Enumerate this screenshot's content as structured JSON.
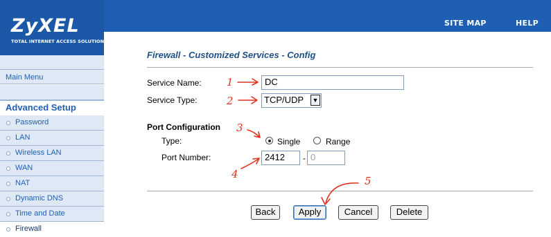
{
  "brand": {
    "logo": "ZyXEL",
    "tagline": "TOTAL INTERNET ACCESS SOLUTION"
  },
  "header": {
    "links": [
      {
        "label": "SITE MAP"
      },
      {
        "label": "HELP"
      }
    ]
  },
  "sidebar": {
    "main_menu": "Main Menu",
    "section": "Advanced Setup",
    "items": [
      {
        "label": "Password"
      },
      {
        "label": "LAN"
      },
      {
        "label": "Wireless LAN"
      },
      {
        "label": "WAN"
      },
      {
        "label": "NAT"
      },
      {
        "label": "Dynamic DNS"
      },
      {
        "label": "Time and Date"
      },
      {
        "label": "Firewall"
      }
    ],
    "current": "Firewall"
  },
  "form": {
    "title": "Firewall - Customized Services - Config",
    "service_name_label": "Service Name:",
    "service_name_value": "DC",
    "service_type_label": "Service Type:",
    "service_type_value": "TCP/UDP",
    "port_config_heading": "Port Configuration",
    "type_label": "Type:",
    "type_options": [
      "Single",
      "Range"
    ],
    "type_selected": "Single",
    "port_number_label": "Port Number:",
    "port_start": "2412",
    "port_separator": "-",
    "port_end": "0"
  },
  "buttons": {
    "back": "Back",
    "apply": "Apply",
    "cancel": "Cancel",
    "delete": "Delete"
  },
  "annotations": [
    "1",
    "2",
    "3",
    "4",
    "5"
  ],
  "colors": {
    "brand_blue": "#1f5fb3",
    "annotation_red": "#e0301e"
  }
}
